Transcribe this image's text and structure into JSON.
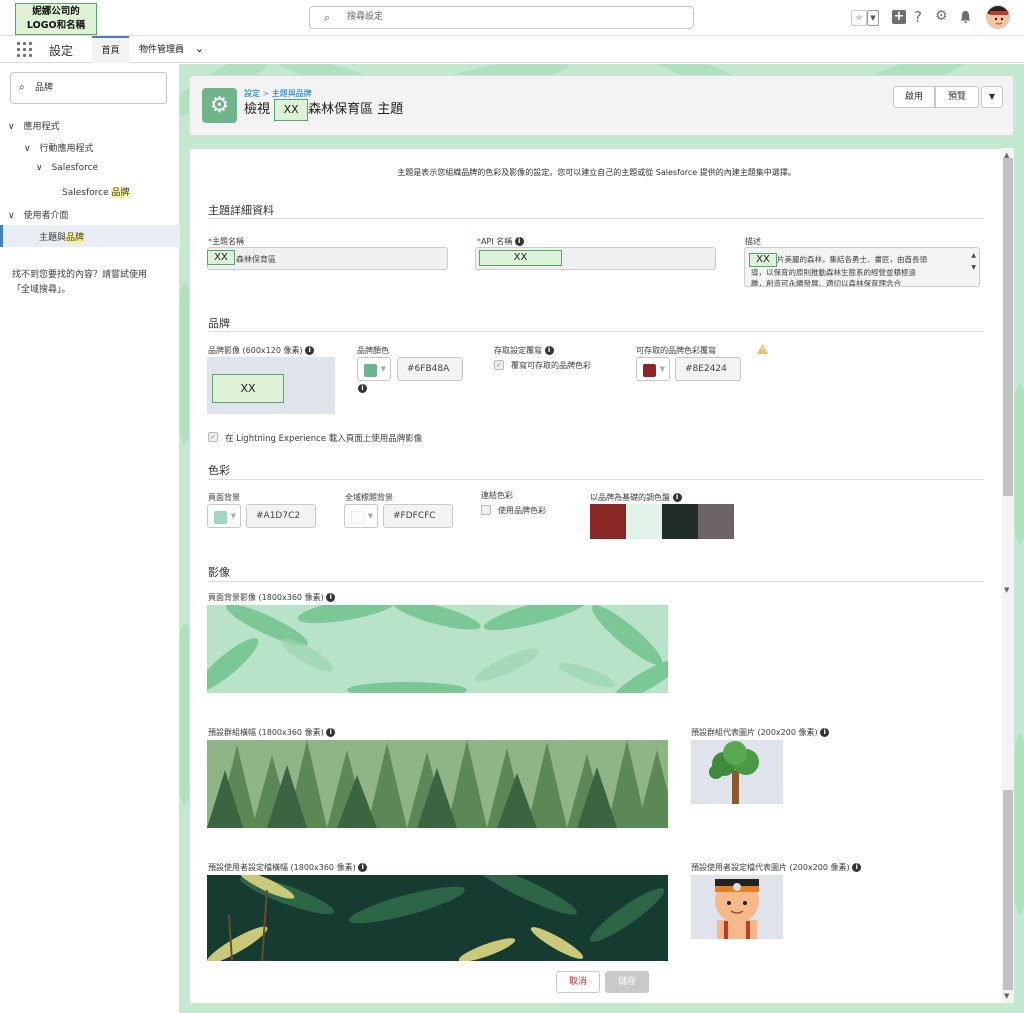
{
  "topbar": {
    "logo_line1": "妮娜公司的",
    "logo_line2": "LOGO和名稱",
    "search_placeholder": "搜尋設定"
  },
  "nav": {
    "title": "設定",
    "tab_home": "首頁",
    "tab_object_manager": "物件管理員"
  },
  "sidebar": {
    "search_value": "品牌",
    "items": [
      {
        "label": "應用程式"
      },
      {
        "label": "行動應用程式"
      },
      {
        "label": "Salesforce"
      },
      {
        "label_pre": "Salesforce ",
        "label_hl": "品牌"
      },
      {
        "label": "使用者介面"
      },
      {
        "label_pre": "主題與",
        "label_hl": "品牌"
      }
    ],
    "help_line1": "找不到您要找的內容？請嘗試使用",
    "help_line2": "「全域搜尋」。"
  },
  "header": {
    "crumb1": "設定",
    "crumb_sep": " > ",
    "crumb2": "主題與品牌",
    "title_prefix": "檢視",
    "title_xx": "XX",
    "title_suffix": "森林保育區 主題",
    "btn_activate": "啟用",
    "btn_preview": "預覽"
  },
  "intro": "主題是表示您組織品牌的色彩及影像的設定。您可以建立自己的主題或從 Salesforce 提供的內建主題集中選擇。",
  "details": {
    "section": "主題詳細資料",
    "name_label": "主題名稱",
    "name_xx": "XX",
    "name_value": "森林保育區",
    "api_label": "API 名稱",
    "api_xx": "XX",
    "desc_label": "描述",
    "desc_xx": "XX",
    "desc_line1": "片美麗的森林，集結各勇士、畫匠，由酋長領",
    "desc_line2": "導，以保育的原則推動森林生態系的經營並積極遠",
    "desc_line3": "離，創造可永續發展、適切以森林保育理念合"
  },
  "brand": {
    "section": "品牌",
    "image_label": "品牌影像 (600x120 像素)",
    "image_xx": "XX",
    "color_label": "品牌顏色",
    "color_hex": "#6FB48A",
    "access_label": "存取設定覆寫",
    "access_check": "覆寫可存取的品牌色彩",
    "accessible_label": "可存取的品牌色彩覆寫",
    "accessible_hex": "#8E2424",
    "lightning_check": "在 Lightning Experience 載入頁面上使用品牌影像"
  },
  "colors": {
    "section": "色彩",
    "page_bg_label": "頁面背景",
    "page_bg_hex": "#A1D7C2",
    "header_bg_label": "全域標題背景",
    "header_bg_hex": "#FDFCFC",
    "link_label": "連結色彩",
    "link_check": "使用品牌色彩",
    "palette_label": "以品牌為基礎的調色盤",
    "palette": [
      "#8b2626",
      "#e1f2e8",
      "#232d28",
      "#6c6364"
    ],
    "swatch_colors": {
      "brand": "#6fb48a",
      "accessible": "#8e2424",
      "page_bg": "#a1d7c2",
      "header_bg": "#fdfcfc"
    }
  },
  "images": {
    "section": "影像",
    "page_bg_label": "頁面背景影像 (1800x360 像素)",
    "group_banner_label": "預設群組橫幅 (1800x360 像素)",
    "group_avatar_label": "預設群組代表圖片 (200x200 像素)",
    "user_banner_label": "預設使用者設定檔橫幅 (1800x360 像素)",
    "user_avatar_label": "預設使用者設定檔代表圖片 (200x200 像素)"
  },
  "footer": {
    "cancel": "取消",
    "save": "儲存"
  }
}
